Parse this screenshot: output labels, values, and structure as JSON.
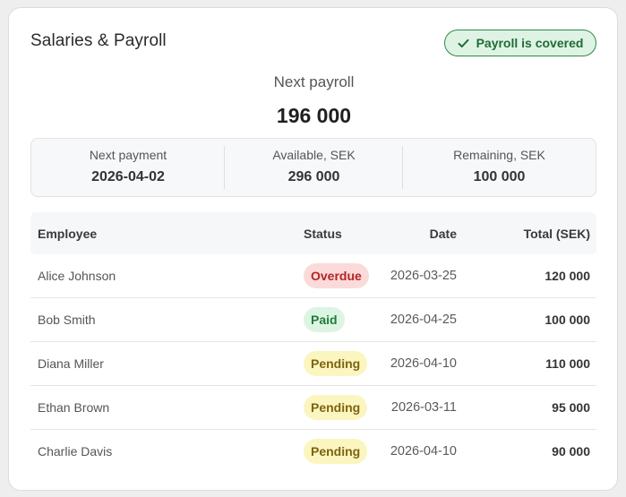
{
  "card": {
    "title": "Salaries & Payroll",
    "badge": {
      "label": "Payroll is covered",
      "icon": "check-icon",
      "color": "#1f6b36"
    }
  },
  "next_payroll": {
    "label": "Next payroll",
    "amount": "196 000"
  },
  "summary": [
    {
      "label": "Next payment",
      "value": "2026-04-02"
    },
    {
      "label": "Available, SEK",
      "value": "296 000"
    },
    {
      "label": "Remaining, SEK",
      "value": "100 000"
    }
  ],
  "table": {
    "headers": {
      "employee": "Employee",
      "status": "Status",
      "date": "Date",
      "total": "Total (SEK)"
    },
    "rows": [
      {
        "employee": "Alice Johnson",
        "status": "Overdue",
        "date": "2026-03-25",
        "total": "120 000"
      },
      {
        "employee": "Bob Smith",
        "status": "Paid",
        "date": "2026-04-25",
        "total": "100 000"
      },
      {
        "employee": "Diana Miller",
        "status": "Pending",
        "date": "2026-04-10",
        "total": "110 000"
      },
      {
        "employee": "Ethan Brown",
        "status": "Pending",
        "date": "2026-03-11",
        "total": "95 000"
      },
      {
        "employee": "Charlie Davis",
        "status": "Pending",
        "date": "2026-04-10",
        "total": "90 000"
      }
    ]
  },
  "colors": {
    "overdue": "#b42525",
    "paid": "#237a3b",
    "pending": "#7d6410"
  }
}
